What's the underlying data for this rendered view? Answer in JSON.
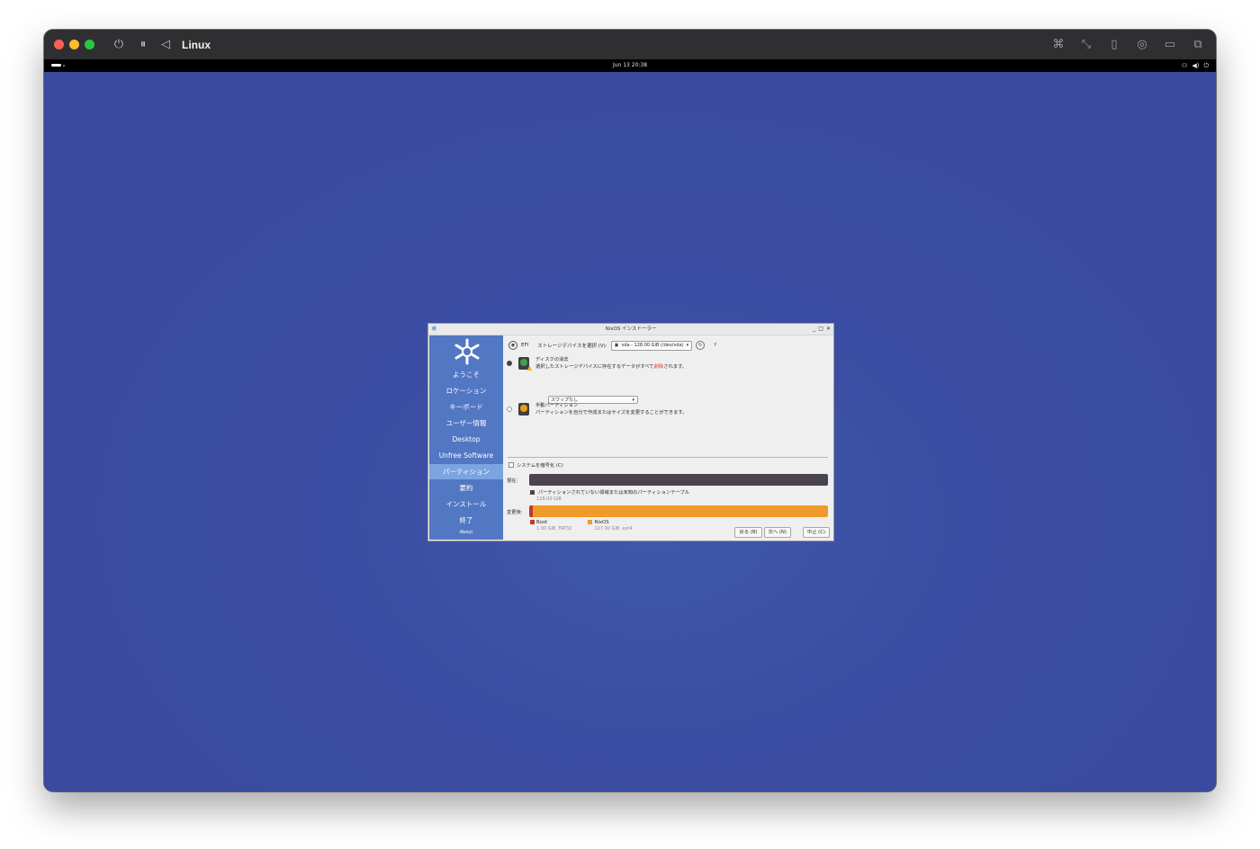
{
  "vm_window": {
    "title": "Linux"
  },
  "gnome_bar": {
    "clock": "Jun 13  20:38"
  },
  "installer": {
    "title": "NixOS インストーラー",
    "sidebar": {
      "items": [
        {
          "label": "ようこそ"
        },
        {
          "label": "ロケーション"
        },
        {
          "label": "キーボード"
        },
        {
          "label": "ユーザー情報"
        },
        {
          "label": "Desktop"
        },
        {
          "label": "Unfree Software"
        },
        {
          "label": "パーティション",
          "active": true
        },
        {
          "label": "要約"
        },
        {
          "label": "インストール"
        },
        {
          "label": "終了"
        }
      ],
      "about": "About"
    },
    "partition": {
      "efi_label": "EFI",
      "storage_label": "ストレージデバイスを選択 (V):",
      "device_value": "vda - 128.00 GiB (/dev/vda)",
      "help": "?",
      "erase": {
        "title": "ディスクの消去",
        "desc_before": "選択したストレージデバイスに存在するデータがすべて",
        "desc_danger": "削除",
        "desc_after": "されます。",
        "selected": true
      },
      "swap_value": "スワップなし",
      "manual": {
        "title": "手動パーティション",
        "desc": "パーティションを自分で作成またはサイズを変更することができます。",
        "selected": false
      },
      "encrypt_label": "システムを暗号化 (C)",
      "current_label": "現在:",
      "current_legend": "パーティションされていない領域または未知のパーティションテーブル",
      "current_size": "128.00 GiB",
      "after_label": "変更後:",
      "after_legend": [
        {
          "name": "Boot",
          "size": "1.00 GiB",
          "fs": "FAT32",
          "color": "#c1392b",
          "fraction": 0.0078
        },
        {
          "name": "NixOS",
          "size": "127.00 GiB",
          "fs": "ext4",
          "color": "#f09a27",
          "fraction": 0.9922
        }
      ],
      "colors": {
        "accent": "#5277c3",
        "current_bar": "#4b4350"
      }
    },
    "buttons": {
      "back": "戻る (B)",
      "next": "次へ (N)",
      "cancel": "中止 (C)"
    }
  }
}
